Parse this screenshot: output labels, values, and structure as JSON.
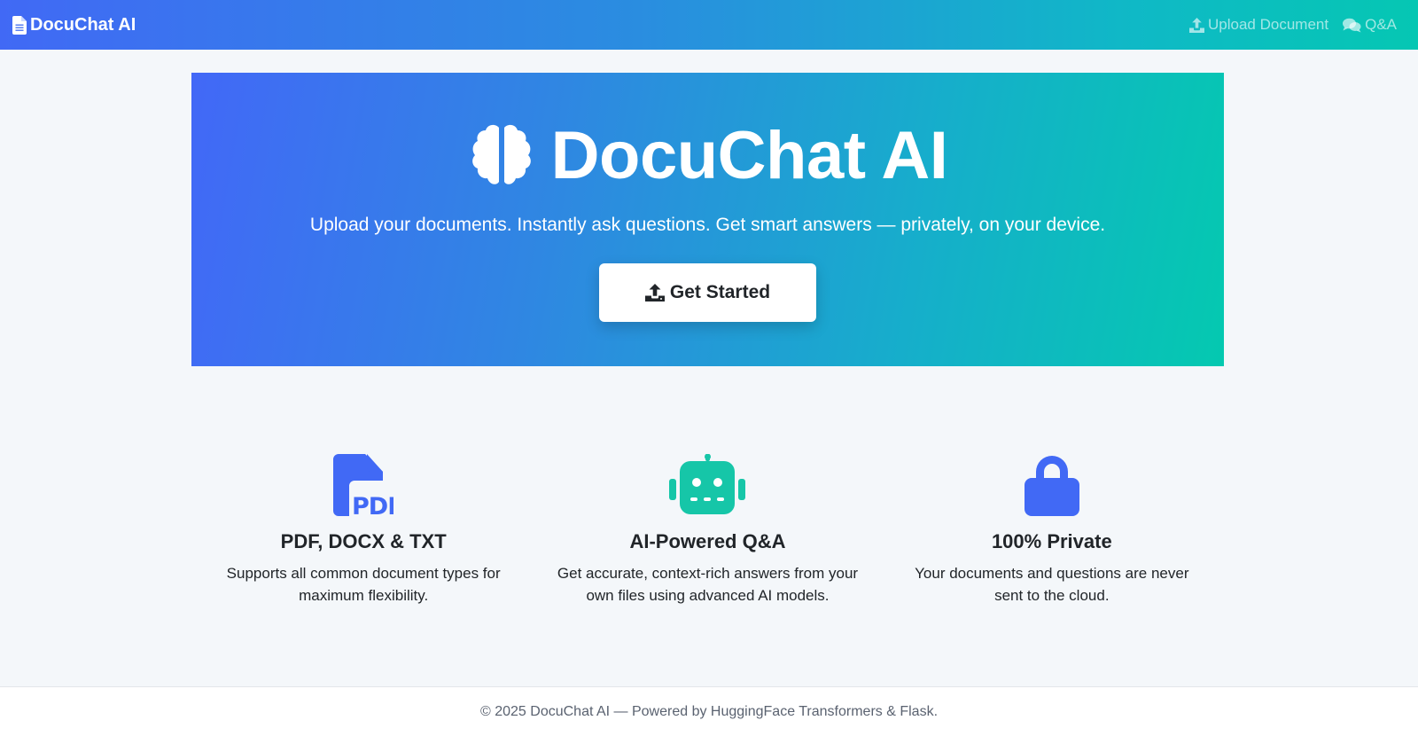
{
  "navbar": {
    "brand": "DocuChat AI",
    "brand_icon": "file-text-icon",
    "links": [
      {
        "label": "Upload Document",
        "icon": "upload-icon"
      },
      {
        "label": "Q&A",
        "icon": "comments-icon"
      }
    ]
  },
  "hero": {
    "title": "DocuChat AI",
    "icon": "brain-icon",
    "subtitle": "Upload your documents. Instantly ask questions. Get smart answers — privately, on your device.",
    "cta_label": "Get Started",
    "cta_icon": "upload-icon"
  },
  "features": [
    {
      "icon": "file-pdf-icon",
      "title": "PDF, DOCX & TXT",
      "description": "Supports all common document types for maximum flexibility."
    },
    {
      "icon": "robot-icon",
      "title": "AI-Powered Q&A",
      "description": "Get accurate, context-rich answers from your own files using advanced AI models."
    },
    {
      "icon": "lock-icon",
      "title": "100% Private",
      "description": "Your documents and questions are never sent to the cloud."
    }
  ],
  "footer": {
    "text": "© 2025 DocuChat AI — Powered by HuggingFace Transformers & Flask."
  },
  "colors": {
    "primary_blue": "#4169f5",
    "teal": "#05c7b3",
    "feature_blue": "#4169f5",
    "feature_teal": "#16c6a8"
  }
}
